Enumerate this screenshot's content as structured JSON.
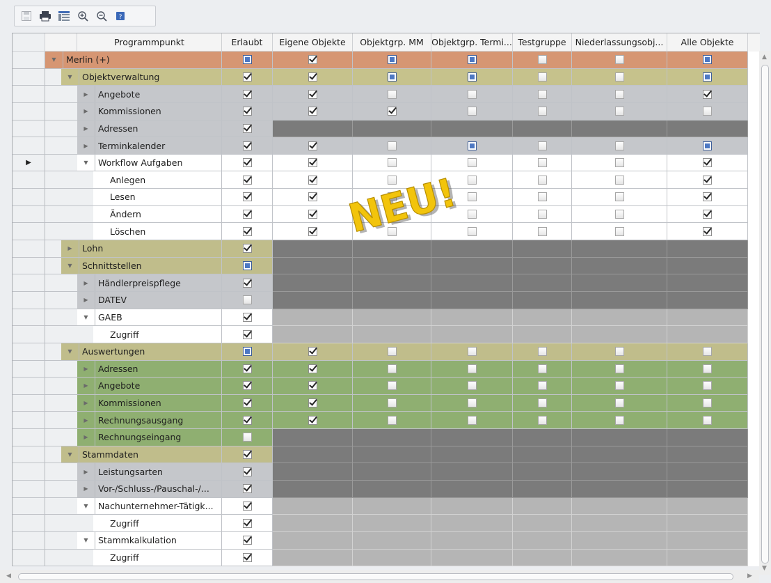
{
  "toolbar": {
    "icons": [
      "save-icon",
      "print-icon",
      "column-chooser-icon",
      "zoom-in-icon",
      "zoom-out-icon",
      "help-icon"
    ]
  },
  "columns": [
    "Programmpunkt",
    "Erlaubt",
    "Eigene Objekte",
    "Objektgrp. MM",
    "Objektgrp. Termi...",
    "Testgruppe",
    "Niederlassungsobj...",
    "Alle Objekte"
  ],
  "overlay": {
    "text": "NEU!"
  },
  "colors": {
    "root": "#d69673",
    "group_olive": "#c6c28c",
    "group_khaki": "#c0bd8b",
    "gray_row": "#c5c7cb",
    "white_row": "#ffffff",
    "green_row": "#8faf71",
    "dark_cell": "#7b7b7b",
    "light_cell": "#b5b5b5"
  },
  "rows": [
    {
      "label": "Merlin (+)",
      "level": 0,
      "toggle": "down",
      "color": "#d69673",
      "erlaubt": "i",
      "cells": [
        "c",
        "i",
        "i",
        "u",
        "u",
        "i"
      ]
    },
    {
      "label": "Objektverwaltung",
      "level": 1,
      "toggle": "down",
      "color": "#c6c28c",
      "erlaubt": "c",
      "cells": [
        "c",
        "i",
        "i",
        "u",
        "u",
        "i"
      ]
    },
    {
      "label": "Angebote",
      "level": 2,
      "toggle": "right",
      "color": "#c5c7cb",
      "erlaubt": "c",
      "cells": [
        "c",
        "u",
        "u",
        "u",
        "u",
        "c"
      ]
    },
    {
      "label": "Kommissionen",
      "level": 2,
      "toggle": "right",
      "color": "#c5c7cb",
      "erlaubt": "c",
      "cells": [
        "c",
        "c",
        "u",
        "u",
        "u",
        "u"
      ]
    },
    {
      "label": "Adressen",
      "level": 2,
      "toggle": "right",
      "color": "#c5c7cb",
      "erlaubt": "c",
      "cells": "dark"
    },
    {
      "label": "Terminkalender",
      "level": 2,
      "toggle": "right",
      "color": "#c5c7cb",
      "erlaubt": "c",
      "cells": [
        "c",
        "u",
        "i",
        "u",
        "u",
        "i"
      ]
    },
    {
      "label": "Workflow Aufgaben",
      "level": 2,
      "toggle": "down",
      "color": "#ffffff",
      "erlaubt": "c",
      "cells": [
        "c",
        "u",
        "u",
        "u",
        "u",
        "c"
      ],
      "current": true
    },
    {
      "label": "Anlegen",
      "level": 3,
      "toggle": "",
      "color": "#ffffff",
      "erlaubt": "c",
      "cells": [
        "c",
        "u",
        "u",
        "u",
        "u",
        "c"
      ]
    },
    {
      "label": "Lesen",
      "level": 3,
      "toggle": "",
      "color": "#ffffff",
      "erlaubt": "c",
      "cells": [
        "c",
        "u",
        "u",
        "u",
        "u",
        "c"
      ]
    },
    {
      "label": "Ändern",
      "level": 3,
      "toggle": "",
      "color": "#ffffff",
      "erlaubt": "c",
      "cells": [
        "c",
        "u",
        "u",
        "u",
        "u",
        "c"
      ]
    },
    {
      "label": "Löschen",
      "level": 3,
      "toggle": "",
      "color": "#ffffff",
      "erlaubt": "c",
      "cells": [
        "c",
        "u",
        "u",
        "u",
        "u",
        "c"
      ]
    },
    {
      "label": "Lohn",
      "level": 1,
      "toggle": "right",
      "color": "#c0bd8b",
      "erlaubt": "c",
      "cells": "dark"
    },
    {
      "label": "Schnittstellen",
      "level": 1,
      "toggle": "down",
      "color": "#c0bd8b",
      "erlaubt": "i",
      "cells": "dark"
    },
    {
      "label": "Händlerpreispflege",
      "level": 2,
      "toggle": "right",
      "color": "#c5c7cb",
      "erlaubt": "c",
      "cells": "dark"
    },
    {
      "label": "DATEV",
      "level": 2,
      "toggle": "right",
      "color": "#c5c7cb",
      "erlaubt": "u",
      "cells": "dark"
    },
    {
      "label": "GAEB",
      "level": 2,
      "toggle": "down",
      "color": "#ffffff",
      "erlaubt": "c",
      "cells": "light"
    },
    {
      "label": "Zugriff",
      "level": 3,
      "toggle": "",
      "color": "#ffffff",
      "erlaubt": "c",
      "cells": "light"
    },
    {
      "label": "Auswertungen",
      "level": 1,
      "toggle": "down",
      "color": "#c0bd8b",
      "erlaubt": "i",
      "cells": [
        "c",
        "u",
        "u",
        "u",
        "u",
        "u"
      ],
      "cellcolor": "#c0bd8b"
    },
    {
      "label": "Adressen",
      "level": 2,
      "toggle": "right",
      "color": "#8faf71",
      "erlaubt": "c",
      "cells": [
        "c",
        "u",
        "u",
        "u",
        "u",
        "u"
      ],
      "cellcolor": "#8faf71"
    },
    {
      "label": "Angebote",
      "level": 2,
      "toggle": "right",
      "color": "#8faf71",
      "erlaubt": "c",
      "cells": [
        "c",
        "u",
        "u",
        "u",
        "u",
        "u"
      ],
      "cellcolor": "#8faf71"
    },
    {
      "label": "Kommissionen",
      "level": 2,
      "toggle": "right",
      "color": "#8faf71",
      "erlaubt": "c",
      "cells": [
        "c",
        "u",
        "u",
        "u",
        "u",
        "u"
      ],
      "cellcolor": "#8faf71"
    },
    {
      "label": "Rechnungsausgang",
      "level": 2,
      "toggle": "right",
      "color": "#8faf71",
      "erlaubt": "c",
      "cells": [
        "c",
        "u",
        "u",
        "u",
        "u",
        "u"
      ],
      "cellcolor": "#8faf71"
    },
    {
      "label": "Rechnungseingang",
      "level": 2,
      "toggle": "right",
      "color": "#8faf71",
      "erlaubt": "u",
      "cells": "dark"
    },
    {
      "label": "Stammdaten",
      "level": 1,
      "toggle": "down",
      "color": "#c0bd8b",
      "erlaubt": "c",
      "cells": "dark"
    },
    {
      "label": "Leistungsarten",
      "level": 2,
      "toggle": "right",
      "color": "#c5c7cb",
      "erlaubt": "c",
      "cells": "dark"
    },
    {
      "label": "Vor-/Schluss-/Pauschal-/...",
      "level": 2,
      "toggle": "right",
      "color": "#c5c7cb",
      "erlaubt": "c",
      "cells": "dark"
    },
    {
      "label": "Nachunternehmer-Tätigk...",
      "level": 2,
      "toggle": "down",
      "color": "#ffffff",
      "erlaubt": "c",
      "cells": "light"
    },
    {
      "label": "Zugriff",
      "level": 3,
      "toggle": "",
      "color": "#ffffff",
      "erlaubt": "c",
      "cells": "light"
    },
    {
      "label": "Stammkalkulation",
      "level": 2,
      "toggle": "down",
      "color": "#ffffff",
      "erlaubt": "c",
      "cells": "light"
    },
    {
      "label": "Zugriff",
      "level": 3,
      "toggle": "",
      "color": "#ffffff",
      "erlaubt": "c",
      "cells": "light"
    }
  ]
}
